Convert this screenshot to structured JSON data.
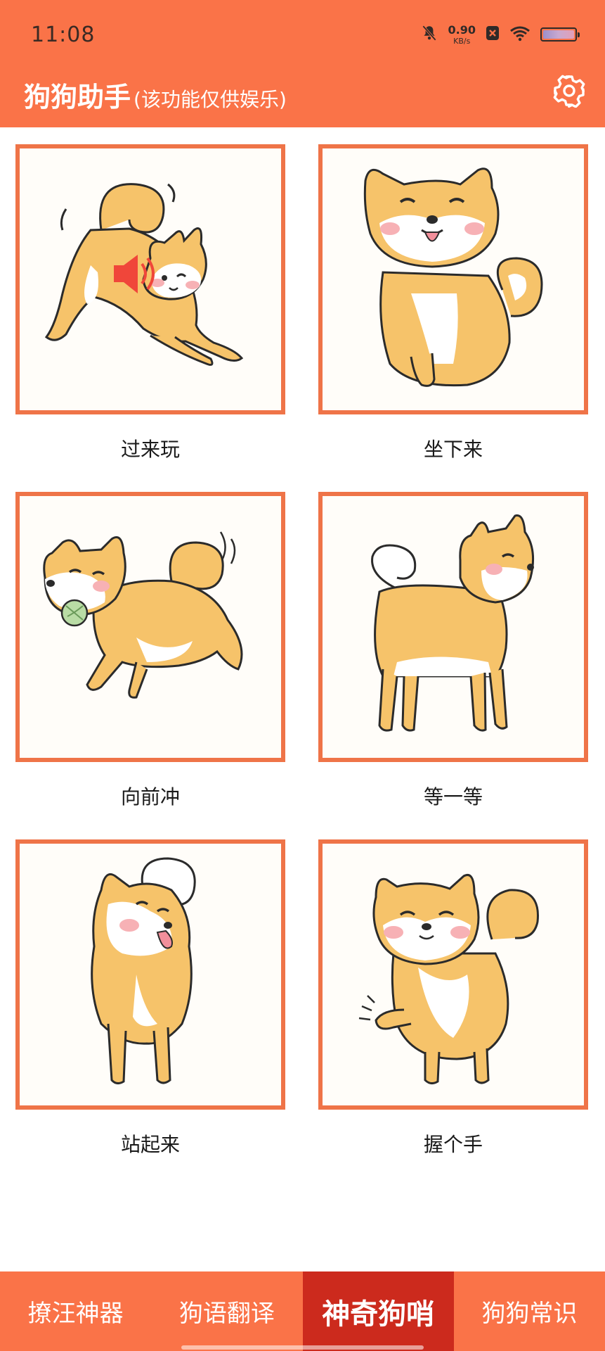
{
  "status_bar": {
    "time": "11:08",
    "net_speed_value": "0.90",
    "net_speed_unit": "KB/s",
    "icons": [
      "bell-muted-icon",
      "app-notification-icon",
      "wifi-icon",
      "battery-icon"
    ]
  },
  "header": {
    "title": "狗狗助手",
    "subtitle": "(该功能仅供娱乐)",
    "settings_icon": "gear-icon"
  },
  "commands": [
    {
      "label": "过来玩",
      "image": "shiba-play-bow",
      "playing": true
    },
    {
      "label": "坐下来",
      "image": "shiba-sitting"
    },
    {
      "label": "向前冲",
      "image": "shiba-running-ball"
    },
    {
      "label": "等一等",
      "image": "shiba-standing-side"
    },
    {
      "label": "站起来",
      "image": "shiba-standing-up"
    },
    {
      "label": "握个手",
      "image": "shiba-shake-paw"
    }
  ],
  "bottom_nav": {
    "items": [
      "撩汪神器",
      "狗语翻译",
      "神奇狗哨",
      "狗狗常识"
    ],
    "active_index": 2
  },
  "colors": {
    "brand": "#fa7348",
    "card_border": "#ef7448",
    "active_tab": "#cc2a1d",
    "dog_body": "#f6c36a",
    "dog_white": "#ffffff",
    "blush": "#f7b1b5"
  }
}
